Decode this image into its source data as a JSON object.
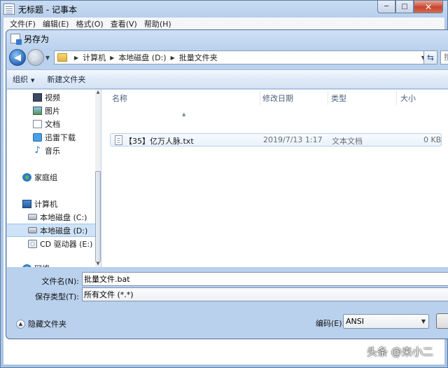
{
  "notepad": {
    "title": "无标题 - 记事本",
    "menus": [
      "文件(F)",
      "编辑(E)",
      "格式(O)",
      "查看(V)",
      "帮助(H)"
    ],
    "window_controls": {
      "minimize": "─",
      "maximize": "□",
      "close": "✕"
    }
  },
  "dialog": {
    "title": "另存为",
    "address": {
      "crumbs": [
        "计算机",
        "本地磁盘 (D:)",
        "批量文件夹"
      ],
      "search_placeholder": "搜"
    },
    "commands": {
      "organize": "组织",
      "new_folder": "新建文件夹"
    },
    "nav_items": [
      {
        "label": "视频",
        "icon": "video-icon"
      },
      {
        "label": "图片",
        "icon": "picture-icon"
      },
      {
        "label": "文档",
        "icon": "document-icon"
      },
      {
        "label": "迅雷下载",
        "icon": "download-icon"
      },
      {
        "label": "音乐",
        "icon": "music-icon"
      },
      {
        "label": "家庭组",
        "icon": "homegroup-icon"
      },
      {
        "label": "计算机",
        "icon": "computer-icon"
      },
      {
        "label": "本地磁盘 (C:)",
        "icon": "drive-icon"
      },
      {
        "label": "本地磁盘 (D:)",
        "icon": "drive-icon",
        "selected": true
      },
      {
        "label": "CD 驱动器 (E:) I",
        "icon": "cd-drive-icon"
      },
      {
        "label": "网络",
        "icon": "network-icon"
      }
    ],
    "columns": {
      "name": "名称",
      "modified": "修改日期",
      "type": "类型",
      "size": "大小"
    },
    "files": [
      {
        "name": "【35】亿万人脉.txt",
        "modified": "2019/7/13 1:17",
        "type": "文本文档",
        "size": "0 KB"
      }
    ],
    "filename_label": "文件名(N):",
    "filename_value": "批量文件.bat",
    "filetype_label": "保存类型(T):",
    "filetype_value": "所有文件 (*.*)",
    "hide_folders": "隐藏文件夹",
    "encoding_label": "编码(E):",
    "encoding_value": "ANSI"
  },
  "watermark": "头条 @来小二",
  "colors": {
    "accent": "#3a78c9",
    "selection": "#cfe3f8",
    "frame": "#b9d1ed"
  }
}
